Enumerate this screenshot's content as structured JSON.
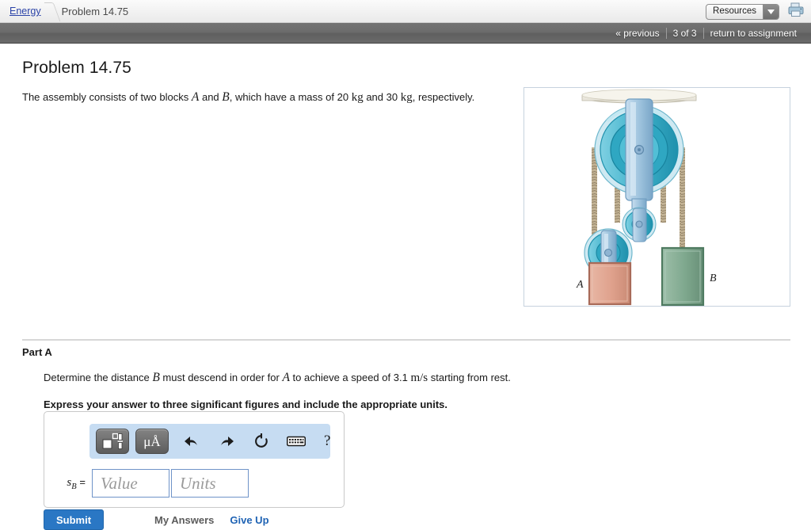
{
  "topbar": {
    "breadcrumb_link": "Energy",
    "breadcrumb_current": "Problem 14.75",
    "resources_label": "Resources",
    "resources_arrow_icon": "chevron-down-icon",
    "print_icon": "printer-icon"
  },
  "nav": {
    "previous": "« previous",
    "counter": "3 of 3",
    "return": "return to assignment"
  },
  "problem": {
    "title": "Problem 14.75",
    "stem_part1": "The assembly consists of two blocks",
    "var_a": "A",
    "stem_and": "and",
    "var_b": "B",
    "stem_part2": ", which have a mass of 20",
    "unit_kg_1": "kg",
    "stem_and2": "and 30",
    "unit_kg_2": "kg",
    "stem_part3": ", respectively."
  },
  "figure": {
    "label_a": "A",
    "label_b": "B",
    "colors": {
      "block_a": "#dfa18c",
      "block_a_border": "#a86a58",
      "block_b": "#7fa88e",
      "block_b_border": "#4e7a60",
      "pulley": "#43b4cd",
      "pulley_dark": "#1f91ad",
      "pulley_light": "#a8d9e6",
      "bracket": "#9fc4de",
      "bracket_dark": "#6f9dc0",
      "rope": "#b8a88c",
      "ceiling": "#e9e6dc",
      "frame_border": "#c6d2de"
    }
  },
  "part_a": {
    "heading": "Part A",
    "question_part1": "Determine the distance",
    "var_b": "B",
    "question_part2": "must descend in order for",
    "var_a": "A",
    "question_part3": "to achieve a speed of 3.1",
    "unit_speed": "m/s",
    "question_part4": "starting from rest.",
    "instruction": "Express your answer to three significant figures and include the appropriate units."
  },
  "answer": {
    "toolbar": {
      "template_icon": "math-template-icon",
      "units_icon": "units-micro-angstrom-icon",
      "units_label": "μÅ",
      "undo_icon": "undo-arrow-icon",
      "redo_icon": "redo-arrow-icon",
      "reset_icon": "reset-circular-arrow-icon",
      "keyboard_icon": "keyboard-icon",
      "help_label": "?"
    },
    "label_symbol": "s",
    "label_subscript": "B",
    "label_equals": "=",
    "value_placeholder": "Value",
    "units_placeholder": "Units",
    "value_current": "",
    "units_current": ""
  },
  "actions": {
    "submit": "Submit",
    "my_answers": "My Answers",
    "give_up": "Give Up"
  }
}
